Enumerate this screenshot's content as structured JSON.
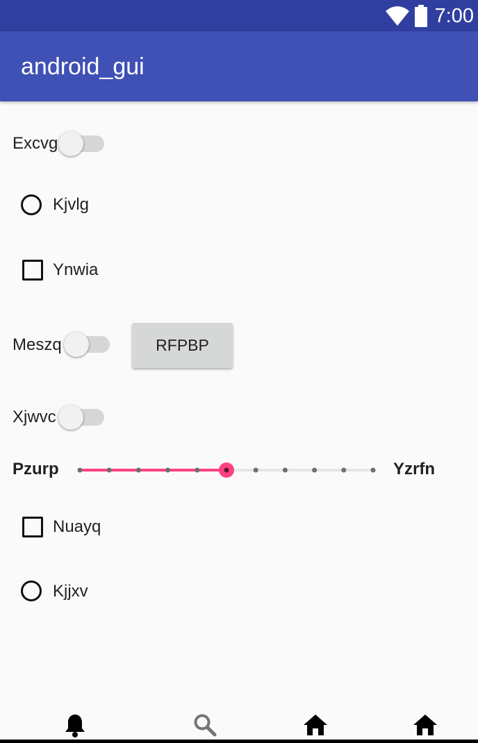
{
  "status_bar": {
    "time": "7:00",
    "icons": [
      "wifi-icon",
      "battery-icon"
    ]
  },
  "app_bar": {
    "title": "android_gui"
  },
  "controls": {
    "switch1": {
      "label": "Excvg",
      "on": false
    },
    "radio1": {
      "label": "Kjvlg",
      "checked": false
    },
    "checkbox1": {
      "label": "Ynwia",
      "checked": false
    },
    "switch2": {
      "label": "Meszq",
      "on": false
    },
    "button1": {
      "label": "RFPBP"
    },
    "switch3": {
      "label": "Xjwvc",
      "on": false
    },
    "seekbar": {
      "label_left": "Pzurp",
      "label_right": "Yzrfn",
      "min": 0,
      "max": 10,
      "value": 5
    },
    "checkbox2": {
      "label": "Nuayq",
      "checked": false
    },
    "radio2": {
      "label": "Kjjxv",
      "checked": false
    }
  },
  "bottom_nav": {
    "items": [
      "bell-icon",
      "search-icon",
      "home-icon",
      "home-icon"
    ]
  },
  "colors": {
    "status_bar": "#303f9f",
    "app_bar": "#3f51b5",
    "accent": "#ff4081",
    "background": "#fafafa"
  }
}
